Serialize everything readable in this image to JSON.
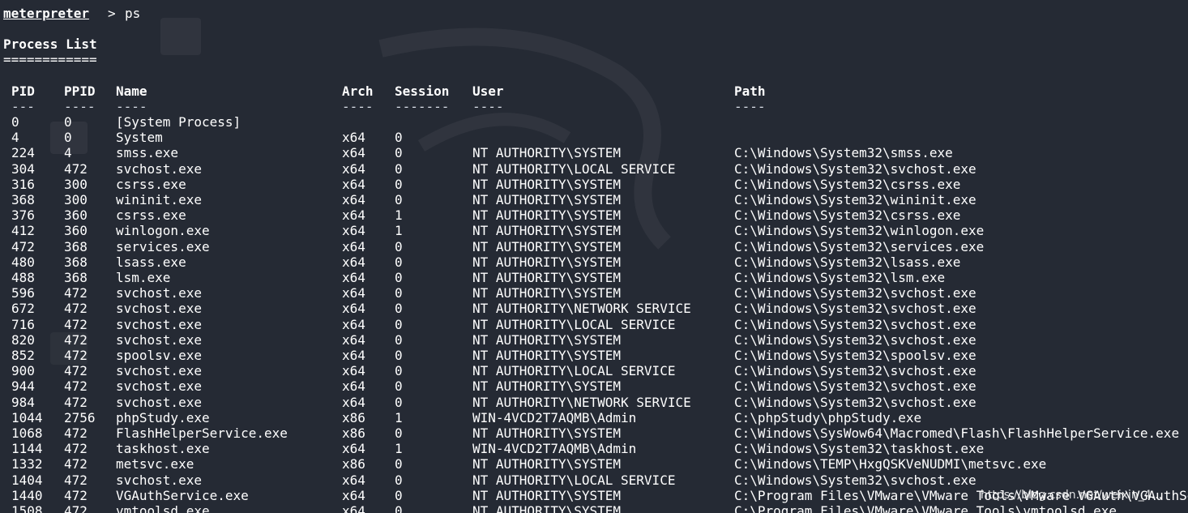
{
  "prompt": {
    "name": "meterpreter",
    "symbol": ">",
    "command": "ps"
  },
  "title": "Process List",
  "title_rule": "============",
  "columns": [
    "PID",
    "PPID",
    "Name",
    "Arch",
    "Session",
    "User",
    "Path"
  ],
  "dashes": [
    "---",
    "----",
    "----",
    "----",
    "-------",
    "----",
    "----"
  ],
  "rows": [
    [
      "0",
      "0",
      "[System Process]",
      "",
      "",
      "",
      ""
    ],
    [
      "4",
      "0",
      "System",
      "x64",
      "0",
      "",
      ""
    ],
    [
      "224",
      "4",
      "smss.exe",
      "x64",
      "0",
      "NT AUTHORITY\\SYSTEM",
      "C:\\Windows\\System32\\smss.exe"
    ],
    [
      "304",
      "472",
      "svchost.exe",
      "x64",
      "0",
      "NT AUTHORITY\\LOCAL SERVICE",
      "C:\\Windows\\System32\\svchost.exe"
    ],
    [
      "316",
      "300",
      "csrss.exe",
      "x64",
      "0",
      "NT AUTHORITY\\SYSTEM",
      "C:\\Windows\\System32\\csrss.exe"
    ],
    [
      "368",
      "300",
      "wininit.exe",
      "x64",
      "0",
      "NT AUTHORITY\\SYSTEM",
      "C:\\Windows\\System32\\wininit.exe"
    ],
    [
      "376",
      "360",
      "csrss.exe",
      "x64",
      "1",
      "NT AUTHORITY\\SYSTEM",
      "C:\\Windows\\System32\\csrss.exe"
    ],
    [
      "412",
      "360",
      "winlogon.exe",
      "x64",
      "1",
      "NT AUTHORITY\\SYSTEM",
      "C:\\Windows\\System32\\winlogon.exe"
    ],
    [
      "472",
      "368",
      "services.exe",
      "x64",
      "0",
      "NT AUTHORITY\\SYSTEM",
      "C:\\Windows\\System32\\services.exe"
    ],
    [
      "480",
      "368",
      "lsass.exe",
      "x64",
      "0",
      "NT AUTHORITY\\SYSTEM",
      "C:\\Windows\\System32\\lsass.exe"
    ],
    [
      "488",
      "368",
      "lsm.exe",
      "x64",
      "0",
      "NT AUTHORITY\\SYSTEM",
      "C:\\Windows\\System32\\lsm.exe"
    ],
    [
      "596",
      "472",
      "svchost.exe",
      "x64",
      "0",
      "NT AUTHORITY\\SYSTEM",
      "C:\\Windows\\System32\\svchost.exe"
    ],
    [
      "672",
      "472",
      "svchost.exe",
      "x64",
      "0",
      "NT AUTHORITY\\NETWORK SERVICE",
      "C:\\Windows\\System32\\svchost.exe"
    ],
    [
      "716",
      "472",
      "svchost.exe",
      "x64",
      "0",
      "NT AUTHORITY\\LOCAL SERVICE",
      "C:\\Windows\\System32\\svchost.exe"
    ],
    [
      "820",
      "472",
      "svchost.exe",
      "x64",
      "0",
      "NT AUTHORITY\\SYSTEM",
      "C:\\Windows\\System32\\svchost.exe"
    ],
    [
      "852",
      "472",
      "spoolsv.exe",
      "x64",
      "0",
      "NT AUTHORITY\\SYSTEM",
      "C:\\Windows\\System32\\spoolsv.exe"
    ],
    [
      "900",
      "472",
      "svchost.exe",
      "x64",
      "0",
      "NT AUTHORITY\\LOCAL SERVICE",
      "C:\\Windows\\System32\\svchost.exe"
    ],
    [
      "944",
      "472",
      "svchost.exe",
      "x64",
      "0",
      "NT AUTHORITY\\SYSTEM",
      "C:\\Windows\\System32\\svchost.exe"
    ],
    [
      "984",
      "472",
      "svchost.exe",
      "x64",
      "0",
      "NT AUTHORITY\\NETWORK SERVICE",
      "C:\\Windows\\System32\\svchost.exe"
    ],
    [
      "1044",
      "2756",
      "phpStudy.exe",
      "x86",
      "1",
      "WIN-4VCD2T7AQMB\\Admin",
      "C:\\phpStudy\\phpStudy.exe"
    ],
    [
      "1068",
      "472",
      "FlashHelperService.exe",
      "x86",
      "0",
      "NT AUTHORITY\\SYSTEM",
      "C:\\Windows\\SysWow64\\Macromed\\Flash\\FlashHelperService.exe"
    ],
    [
      "1144",
      "472",
      "taskhost.exe",
      "x64",
      "1",
      "WIN-4VCD2T7AQMB\\Admin",
      "C:\\Windows\\System32\\taskhost.exe"
    ],
    [
      "1332",
      "472",
      "metsvc.exe",
      "x86",
      "0",
      "NT AUTHORITY\\SYSTEM",
      "C:\\Windows\\TEMP\\HxgQSKVeNUDMI\\metsvc.exe"
    ],
    [
      "1404",
      "472",
      "svchost.exe",
      "x64",
      "0",
      "NT AUTHORITY\\LOCAL SERVICE",
      "C:\\Windows\\System32\\svchost.exe"
    ],
    [
      "1440",
      "472",
      "VGAuthService.exe",
      "x64",
      "0",
      "NT AUTHORITY\\SYSTEM",
      "C:\\Program Files\\VMware\\VMware Tools\\VMware VGAuth\\VGAuthService.exe"
    ],
    [
      "1508",
      "472",
      "vmtoolsd.exe",
      "x64",
      "0",
      "NT AUTHORITY\\SYSTEM",
      "C:\\Program Files\\VMware\\VMware Tools\\vmtoolsd.exe"
    ]
  ],
  "watermark": "https://blog.csdn.net/weixin_4...",
  "colors": {
    "background": "#252a34",
    "text": "#ffffff"
  }
}
